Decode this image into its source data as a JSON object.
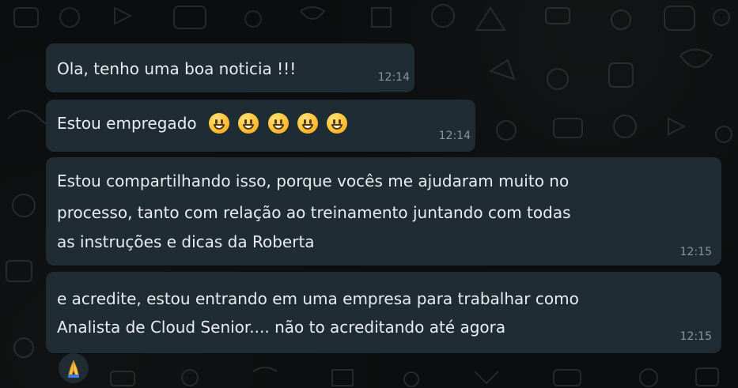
{
  "messages": [
    {
      "text": "Ola, tenho uma boa noticia !!!",
      "time": "12:14"
    },
    {
      "text": "Estou empregado",
      "emoji": [
        "grinning-face",
        "grinning-face",
        "grinning-face",
        "grinning-face",
        "grinning-face"
      ],
      "time": "12:14"
    },
    {
      "lines": [
        "Estou compartilhando isso, porque vocês me ajudaram muito no",
        "processo, tanto com relação ao treinamento juntando com todas",
        "as instruções e dicas da Roberta"
      ],
      "time": "12:15"
    },
    {
      "lines": [
        "e acredite, estou entrando em uma empresa para trabalhar como",
        "Analista de Cloud Senior.... não to acreditando até agora"
      ],
      "time": "12:15"
    }
  ],
  "reaction": {
    "icon": "folded-hands-icon"
  },
  "colors": {
    "bubble": "#1f2c33",
    "text": "#e9edef",
    "time": "#8696a0",
    "background": "#0b0d0e"
  }
}
